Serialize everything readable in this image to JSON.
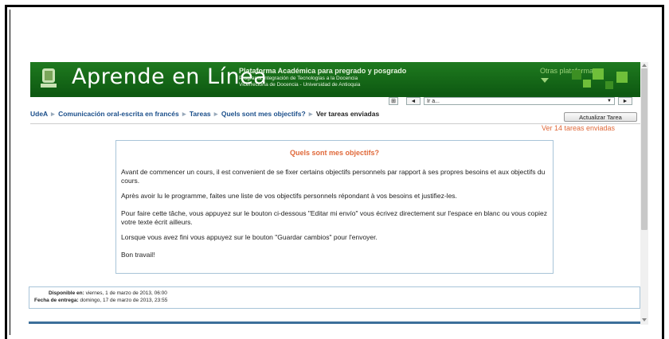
{
  "header": {
    "brand": "Aprende en Línea",
    "tagline_line1": "Plataforma Académica para pregrado y posgrado",
    "tagline_line2": "Programa Integración de Tecnologías a la Docencia",
    "tagline_line3": "Vicerrectoría de Docencia - Universidad de Antioquia",
    "other_platforms": "Otras plataformas"
  },
  "nav": {
    "jump_label": "Ir a...",
    "prev_label": "◄",
    "next_label": "►"
  },
  "breadcrumb": {
    "items": [
      "UdeA",
      "Comunicación oral-escrita en francés",
      "Tareas",
      "Quels sont mes objectifs?",
      "Ver tareas enviadas"
    ],
    "separator": "►"
  },
  "actions": {
    "update_button": "Actualizar Tarea",
    "view_submissions": "Ver 14 tareas enviadas"
  },
  "assignment": {
    "title": "Quels sont mes objectifs?",
    "paragraphs": [
      "Avant de commencer un cours, il est convenient de se fixer certains objectifs personnels par rapport à ses propres besoins et aux objectifs du cours.",
      "Après avoir lu le programme, faites une liste de vos objectifs personnels répondant à vos besoins et justifiez-les.",
      "Pour faire cette tâche, vous appuyez sur le bouton ci-dessous \"Editar mi envío\" vous écrivez directement sur l'espace en blanc ou vous copiez votre texte écrit ailleurs.",
      "Lorsque vous avez fini vous appuyez sur le bouton \"Guardar cambios\" pour l'envoyer.",
      "Bon travail!"
    ]
  },
  "dates": {
    "available_label": "Disponible en:",
    "available_value": "viernes, 1 de marzo de 2013, 06:00",
    "due_label": "Fecha de entrega:",
    "due_value": "domingo, 17 de marzo de 2013, 23:55"
  },
  "colors": {
    "banner_green": "#1f7a1f",
    "accent_orange": "#e0693a",
    "link_blue": "#1a4e8a"
  }
}
